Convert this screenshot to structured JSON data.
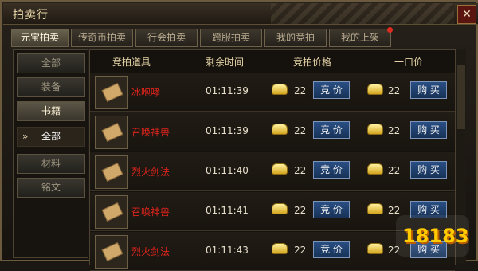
{
  "window": {
    "title": "拍卖行",
    "close": "✕"
  },
  "tabs": [
    {
      "label": "元宝拍卖",
      "active": true
    },
    {
      "label": "传奇币拍卖"
    },
    {
      "label": "行会拍卖"
    },
    {
      "label": "跨服拍卖"
    },
    {
      "label": "我的竞拍"
    },
    {
      "label": "我的上架",
      "notify": true
    }
  ],
  "sidebar": [
    {
      "label": "全部"
    },
    {
      "label": "装备"
    },
    {
      "label": "书籍",
      "active": true
    },
    {
      "label": "全部",
      "sub_active": true,
      "marker": "»"
    },
    {
      "label": "材料"
    },
    {
      "label": "铭文"
    }
  ],
  "table": {
    "columns": [
      "竞拍道具",
      "剩余时间",
      "竞拍价格",
      "一口价"
    ],
    "rows": [
      {
        "name": "冰咆哮",
        "time": "01:11:39",
        "bid": "22",
        "buyout": "22"
      },
      {
        "name": "召唤神兽",
        "time": "01:11:39",
        "bid": "22",
        "buyout": "22"
      },
      {
        "name": "烈火剑法",
        "time": "01:11:40",
        "bid": "22",
        "buyout": "22"
      },
      {
        "name": "召唤神兽",
        "time": "01:11:41",
        "bid": "22",
        "buyout": "22"
      },
      {
        "name": "烈火剑法",
        "time": "01:11:43",
        "bid": "22",
        "buyout": "22"
      }
    ],
    "bid_button": "竞 价",
    "buy_button": "购 买"
  },
  "icons": {
    "thumb": "skill-book-icon",
    "gold": "gold-ingot-icon"
  },
  "watermark": {
    "text": "18183"
  }
}
